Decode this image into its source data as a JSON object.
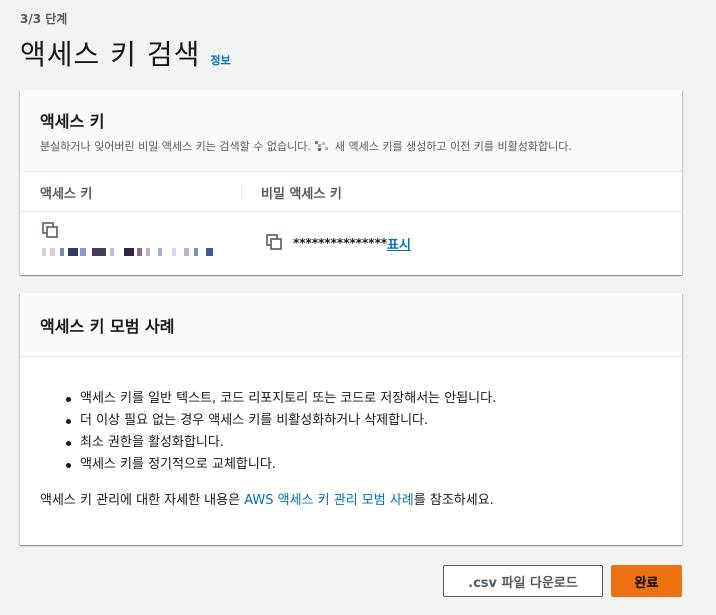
{
  "header": {
    "step": "3/3 단계",
    "title": "액세스 키 검색",
    "info_link": "정보"
  },
  "keys_panel": {
    "title": "액세스 키",
    "description_before": "분실하거나 잊어버린 비밀 액세스 키는 검색할 수 없습니다.",
    "description_after": "새 액세스 키를 생성하고 이전 키를 비활성화합니다.",
    "col_access_key": "액세스 키",
    "col_secret_key": "비밀 액세스 키",
    "secret_masked": "***************",
    "show_link": "표시",
    "copy_icon": "copy-icon"
  },
  "best_practices": {
    "title": "액세스 키 모범 사례",
    "items": [
      "액세스 키를 일반 텍스트, 코드 리포지토리 또는 코드로 저장해서는 안됩니다.",
      "더 이상 필요 없는 경우 액세스 키를 비활성화하거나 삭제합니다.",
      "최소 권한을 활성화합니다.",
      "액세스 키를 정기적으로 교체합니다."
    ],
    "ref_before": "액세스 키 관리에 대한 자세한 내용은 ",
    "ref_link": "AWS 액세스 키 관리 모범 사례",
    "ref_after": "를 참조하세요."
  },
  "footer": {
    "csv_button": ".csv 파일 다운로드",
    "done_button": "완료"
  },
  "colors": {
    "link": "#0073bb",
    "primary_button": "#ec7211",
    "background": "#f2f3f3"
  }
}
